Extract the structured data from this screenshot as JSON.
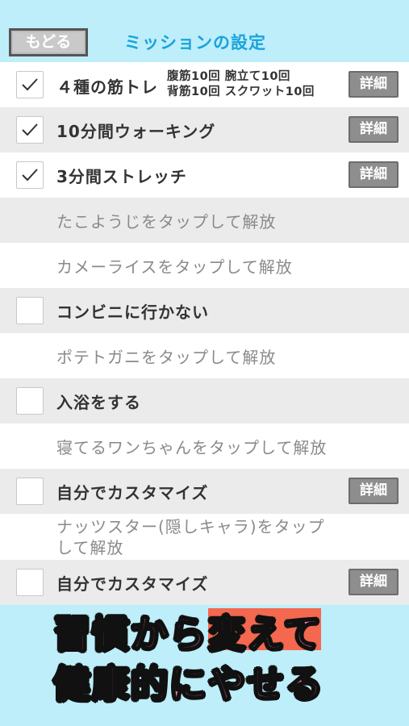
{
  "header": {
    "back_label": "もどる",
    "title": "ミッションの設定"
  },
  "missions": [
    {
      "label": "４種の筋トレ",
      "checked": true,
      "detail": "詳細",
      "sub": [
        "腹筋10回  腕立て10回",
        "背筋10回  スクワット10回"
      ]
    },
    {
      "label": "10分間ウォーキング",
      "checked": true,
      "detail": "詳細"
    },
    {
      "label": "3分間ストレッチ",
      "checked": true,
      "detail": "詳細"
    },
    {
      "locked": "たこようじをタップして解放"
    },
    {
      "locked": "カメーライスをタップして解放"
    },
    {
      "label": "コンビニに行かない",
      "checked": false
    },
    {
      "locked": "ポテトガニをタップして解放"
    },
    {
      "label": "入浴をする",
      "checked": false
    },
    {
      "locked": "寝てるワンちゃんをタップして解放"
    },
    {
      "label": "自分でカスタマイズ",
      "checked": false,
      "detail": "詳細"
    },
    {
      "locked": "ナッツスター(隠しキャラ)をタップして解放"
    },
    {
      "label": "自分でカスタマイズ",
      "checked": false,
      "detail": "詳細"
    }
  ],
  "caption": {
    "line1": "習慣から変えて",
    "line2": "健康的にやせる"
  },
  "colors": {
    "background": "#bdeefa",
    "title": "#1aa3dc",
    "caption": "#ff7aa8",
    "highlight": "#f3684f"
  }
}
